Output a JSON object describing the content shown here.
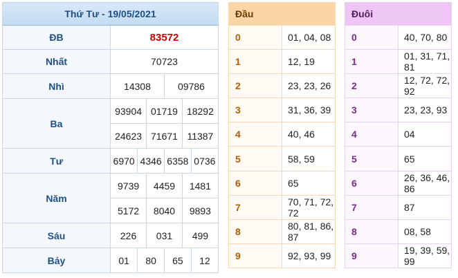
{
  "main": {
    "title": "Thứ Tư - 19/05/2021",
    "prizes": [
      {
        "label": "ĐB",
        "values": [
          "83572"
        ]
      },
      {
        "label": "Nhất",
        "values": [
          "70723"
        ]
      },
      {
        "label": "Nhì",
        "values": [
          "14308",
          "09786"
        ]
      },
      {
        "label": "Ba",
        "values": [
          "93904",
          "01719",
          "18292",
          "24623",
          "71671",
          "11387"
        ]
      },
      {
        "label": "Tư",
        "values": [
          "6970",
          "4346",
          "6358",
          "0736"
        ]
      },
      {
        "label": "Năm",
        "values": [
          "9739",
          "4459",
          "1481",
          "5172",
          "8040",
          "9893"
        ]
      },
      {
        "label": "Sáu",
        "values": [
          "226",
          "031",
          "499"
        ]
      },
      {
        "label": "Bảy",
        "values": [
          "01",
          "80",
          "65",
          "12"
        ]
      }
    ]
  },
  "dau": {
    "header_key": "Đầu",
    "rows": [
      {
        "k": "0",
        "v": "01, 04, 08"
      },
      {
        "k": "1",
        "v": "12, 19"
      },
      {
        "k": "2",
        "v": "23, 23, 26"
      },
      {
        "k": "3",
        "v": "31, 36, 39"
      },
      {
        "k": "4",
        "v": "40, 46"
      },
      {
        "k": "5",
        "v": "58, 59"
      },
      {
        "k": "6",
        "v": "65"
      },
      {
        "k": "7",
        "v": "70, 71, 72, 72"
      },
      {
        "k": "8",
        "v": "80, 81, 86, 87"
      },
      {
        "k": "9",
        "v": "92, 93, 99"
      }
    ]
  },
  "duoi": {
    "header_key": "Đuôi",
    "rows": [
      {
        "k": "0",
        "v": "40, 70, 80"
      },
      {
        "k": "1",
        "v": "01, 31, 71, 81"
      },
      {
        "k": "2",
        "v": "12, 72, 72, 92"
      },
      {
        "k": "3",
        "v": "23, 23, 93"
      },
      {
        "k": "4",
        "v": "04"
      },
      {
        "k": "5",
        "v": "65"
      },
      {
        "k": "6",
        "v": "26, 36, 46, 86"
      },
      {
        "k": "7",
        "v": "87"
      },
      {
        "k": "8",
        "v": "08, 58"
      },
      {
        "k": "9",
        "v": "19, 39, 59, 99"
      }
    ]
  },
  "colors": {
    "special_prize": "#d00000",
    "main_border": "#8fb4dd",
    "dau_header": "#fad5a6",
    "duoi_header": "#edc6f3"
  }
}
